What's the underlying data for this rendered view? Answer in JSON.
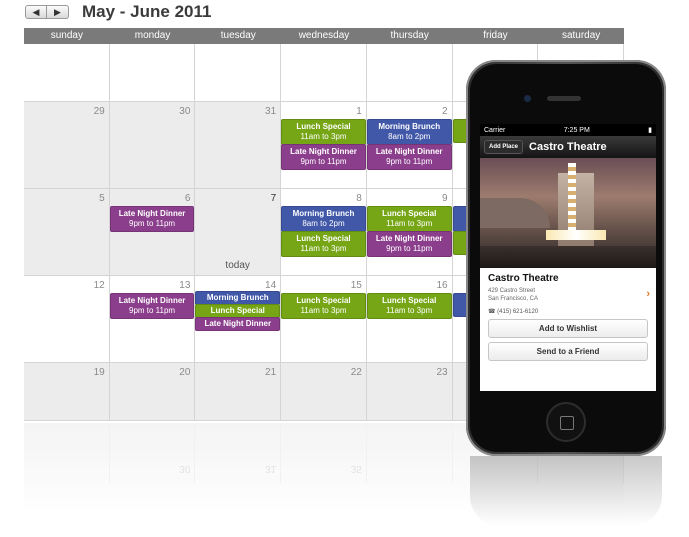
{
  "header": {
    "prev_icon": "◀",
    "next_icon": "▶",
    "title": "May - June 2011"
  },
  "calendar": {
    "days": [
      "sunday",
      "monday",
      "tuesday",
      "wednesday",
      "thursday",
      "friday",
      "saturday"
    ],
    "today_label": "today",
    "weeks": [
      {
        "dates": [
          "",
          "",
          "",
          "",
          "",
          "",
          ""
        ]
      },
      {
        "dates": [
          "29",
          "30",
          "31",
          "1",
          "2",
          "",
          ""
        ]
      },
      {
        "dates": [
          "5",
          "6",
          "7",
          "8",
          "9",
          "",
          ""
        ]
      },
      {
        "dates": [
          "12",
          "13",
          "14",
          "15",
          "16",
          "",
          ""
        ]
      },
      {
        "dates": [
          "19",
          "20",
          "21",
          "22",
          "23",
          "",
          ""
        ]
      }
    ],
    "events": {
      "w1_wed_1": {
        "title": "Lunch Special",
        "time": "11am to 3pm"
      },
      "w1_wed_2": {
        "title": "Late Night Dinner",
        "time": "9pm to 11pm"
      },
      "w1_thu_1": {
        "title": "Morning Brunch",
        "time": "8am to 2pm"
      },
      "w1_thu_2": {
        "title": "Late Night Dinner",
        "time": "9pm to 11pm"
      },
      "w2_mon_1": {
        "title": "Late Night Dinner",
        "time": "9pm to 11pm"
      },
      "w2_wed_1": {
        "title": "Morning Brunch",
        "time": "8am to 2pm"
      },
      "w2_wed_2": {
        "title": "Lunch Special",
        "time": "11am to 3pm"
      },
      "w2_thu_1": {
        "title": "Lunch Special",
        "time": "11am to 3pm"
      },
      "w2_thu_2": {
        "title": "Late Night Dinner",
        "time": "9pm to 11pm"
      },
      "w2_fri_1": {
        "title": "Mo"
      },
      "w3_mon_1": {
        "title": "Late Night Dinner",
        "time": "9pm to 11pm"
      },
      "w3_tue_1": {
        "title": "Morning Brunch"
      },
      "w3_tue_2": {
        "title": "Lunch Special"
      },
      "w3_tue_3": {
        "title": "Late Night Dinner"
      },
      "w3_wed_1": {
        "title": "Lunch Special",
        "time": "11am to 3pm"
      },
      "w3_thu_1": {
        "title": "Lunch Special",
        "time": "11am to 3pm"
      }
    },
    "reflection_dates": [
      "",
      "30",
      "31",
      "",
      "",
      "",
      ""
    ],
    "reflection_partial": [
      "",
      "",
      "",
      "35",
      "",
      "",
      ""
    ]
  },
  "phone": {
    "carrier": "Carrier",
    "time": "7:25 PM",
    "add_place_label": "Add Place",
    "nav_title": "Castro Theatre",
    "place_name": "Castro Theatre",
    "address_line1": "429 Castro Street",
    "address_line2": "San Francisco, CA",
    "phone_number": "(415) 621-6120",
    "wishlist_button": "Add to Wishlist",
    "send_button": "Send to a Friend"
  },
  "colors": {
    "green": "#76a516",
    "purple": "#8b3e8c",
    "blue": "#4158a8"
  }
}
